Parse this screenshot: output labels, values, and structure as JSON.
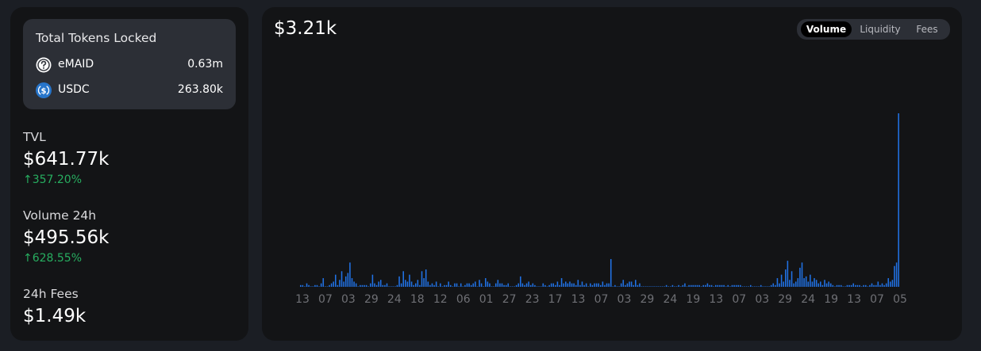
{
  "tokens_locked": {
    "title": "Total Tokens Locked",
    "items": [
      {
        "name": "eMAID",
        "amount": "0.63m",
        "icon": "question-circle-icon"
      },
      {
        "name": "USDC",
        "amount": "263.80k",
        "icon": "usdc-icon"
      }
    ]
  },
  "stats": {
    "tvl": {
      "label": "TVL",
      "value": "$641.77k",
      "change": "↑357.20%"
    },
    "volume": {
      "label": "Volume 24h",
      "value": "$495.56k",
      "change": "↑628.55%"
    },
    "fees": {
      "label": "24h Fees",
      "value": "$1.49k"
    }
  },
  "chart_header": {
    "value": "$3.21k",
    "tabs": [
      {
        "label": "Volume",
        "active": true
      },
      {
        "label": "Liquidity",
        "active": false
      },
      {
        "label": "Fees",
        "active": false
      }
    ]
  },
  "colors": {
    "bar": "#2172e5",
    "positive": "#27ae60"
  },
  "chart_data": {
    "type": "bar",
    "title": "",
    "xlabel": "",
    "ylabel": "",
    "x_tick_labels": [
      "13",
      "07",
      "03",
      "29",
      "24",
      "18",
      "12",
      "06",
      "01",
      "27",
      "23",
      "17",
      "13",
      "07",
      "03",
      "29",
      "24",
      "19",
      "13",
      "07",
      "03",
      "29",
      "24",
      "19",
      "13",
      "07",
      "05"
    ],
    "values_relative": [
      0.01,
      0.01,
      0,
      0.02,
      0.01,
      0,
      0,
      0.01,
      0.01,
      0,
      0.02,
      0.05,
      0,
      0,
      0.01,
      0.02,
      0.03,
      0.07,
      0.01,
      0.04,
      0.09,
      0.03,
      0.06,
      0.08,
      0.14,
      0.05,
      0.03,
      0.02,
      0,
      0.01,
      0.01,
      0.01,
      0.01,
      0,
      0.02,
      0.07,
      0.02,
      0.01,
      0.03,
      0.04,
      0.01,
      0.01,
      0.02,
      0,
      0,
      0,
      0,
      0.01,
      0.06,
      0.02,
      0.09,
      0.04,
      0.03,
      0.07,
      0.03,
      0.01,
      0.02,
      0.04,
      0.01,
      0.09,
      0.05,
      0.1,
      0.03,
      0.01,
      0.02,
      0.01,
      0.03,
      0,
      0.02,
      0,
      0.01,
      0.01,
      0.03,
      0.01,
      0,
      0.02,
      0.02,
      0,
      0.02,
      0,
      0.01,
      0.02,
      0.02,
      0.01,
      0.02,
      0.03,
      0,
      0.04,
      0.02,
      0,
      0.05,
      0.03,
      0.02,
      0,
      0,
      0.02,
      0.04,
      0.02,
      0.02,
      0.01,
      0.01,
      0.02,
      0,
      0,
      0,
      0.01,
      0.02,
      0.06,
      0.02,
      0.01,
      0.02,
      0.03,
      0.01,
      0.02,
      0.01,
      0,
      0,
      0,
      0.02,
      0.01,
      0,
      0.01,
      0.02,
      0.02,
      0.01,
      0.03,
      0.01,
      0.05,
      0.02,
      0.03,
      0.02,
      0.03,
      0.02,
      0.02,
      0.01,
      0.04,
      0.01,
      0.03,
      0.01,
      0.02,
      0,
      0.02,
      0.01,
      0.02,
      0.02,
      0.02,
      0.01,
      0.03,
      0.01,
      0.02,
      0.02,
      0.16,
      0,
      0.01,
      0,
      0,
      0.02,
      0.04,
      0.01,
      0.02,
      0.03,
      0.03,
      0.01,
      0.04,
      0.01,
      0.02,
      0,
      0,
      0,
      0,
      0,
      0,
      0,
      0,
      0,
      0,
      0,
      0,
      0.01,
      0,
      0,
      0.01,
      0,
      0,
      0.01,
      0,
      0.01,
      0.02,
      0,
      0.01,
      0.01,
      0.01,
      0.01,
      0.01,
      0.01,
      0,
      0.01,
      0.01,
      0.02,
      0.01,
      0.01,
      0,
      0.01,
      0.01,
      0.01,
      0.01,
      0.01,
      0,
      0.01,
      0,
      0.01,
      0.01,
      0.01,
      0.01,
      0.01,
      0,
      0,
      0,
      0,
      0.01,
      0,
      0,
      0,
      0,
      0.01,
      0,
      0,
      0,
      0,
      0.01,
      0.02,
      0.01,
      0.05,
      0.02,
      0.07,
      0.03,
      0.1,
      0.15,
      0.04,
      0.09,
      0.02,
      0.03,
      0.05,
      0.11,
      0.14,
      0.05,
      0.06,
      0.03,
      0.07,
      0.03,
      0.05,
      0.04,
      0.02,
      0.03,
      0.01,
      0.04,
      0.02,
      0.03,
      0.02,
      0.01,
      0,
      0.01,
      0.01,
      0.01,
      0,
      0,
      0.01,
      0.01,
      0.01,
      0.02,
      0.01,
      0.01,
      0.01,
      0,
      0.01,
      0.01,
      0,
      0.01,
      0.02,
      0.01,
      0.01,
      0.03,
      0.01,
      0.02,
      0.01,
      0.02,
      0.05,
      0.03,
      0.04,
      0.12,
      0.14,
      1.0
    ]
  }
}
